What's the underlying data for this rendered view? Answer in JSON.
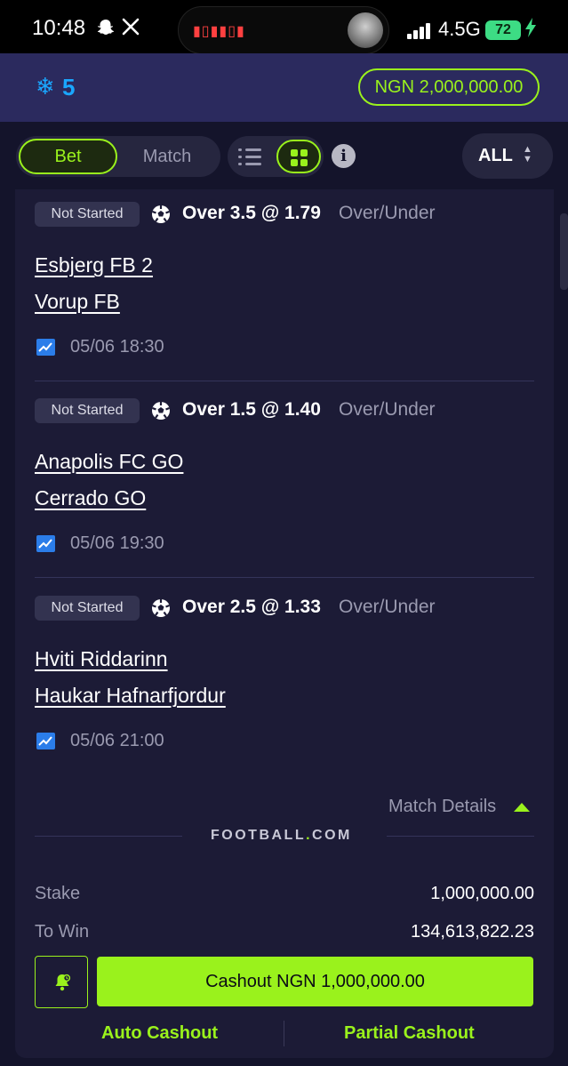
{
  "status_bar": {
    "time": "10:48",
    "network": "4.5G",
    "battery": "72",
    "icons": [
      "snapchat-icon",
      "x-icon",
      "signal-icon",
      "charging-icon"
    ]
  },
  "header": {
    "freeze_icon": "snowflake-icon",
    "freeze_count": "5",
    "balance": "NGN 2,000,000.00"
  },
  "tabs": {
    "bet": "Bet",
    "match": "Match",
    "active": "Bet"
  },
  "view_toggle": {
    "active": "grid"
  },
  "filter": {
    "label": "ALL"
  },
  "selections": [
    {
      "status": "Not Started",
      "pick": "Over 3.5 @ 1.79",
      "market": "Over/Under",
      "home": "Esbjerg FB 2",
      "away": "Vorup FB",
      "kickoff": "05/06 18:30"
    },
    {
      "status": "Not Started",
      "pick": "Over 1.5 @ 1.40",
      "market": "Over/Under",
      "home": "Anapolis FC GO",
      "away": "Cerrado GO",
      "kickoff": "05/06 19:30"
    },
    {
      "status": "Not Started",
      "pick": "Over 2.5 @ 1.33",
      "market": "Over/Under",
      "home": "Hviti Riddarinn",
      "away": "Haukar Hafnarfjordur",
      "kickoff": "05/06 21:00"
    }
  ],
  "match_details_label": "Match Details",
  "brand": {
    "text": "FOOTBALL",
    "dot": ".",
    "suffix": "COM"
  },
  "summary": {
    "stake_label": "Stake",
    "stake_value": "1,000,000.00",
    "to_win_label": "To Win",
    "to_win_value": "134,613,822.23"
  },
  "actions": {
    "cashout": "Cashout NGN 1,000,000.00",
    "auto_cashout": "Auto Cashout",
    "partial_cashout": "Partial Cashout"
  },
  "colors": {
    "accent": "#9af21c",
    "header_bg": "#2b2a5e",
    "page_bg": "#14142b",
    "card_bg": "#1c1b36",
    "freeze": "#1aa7ff"
  }
}
